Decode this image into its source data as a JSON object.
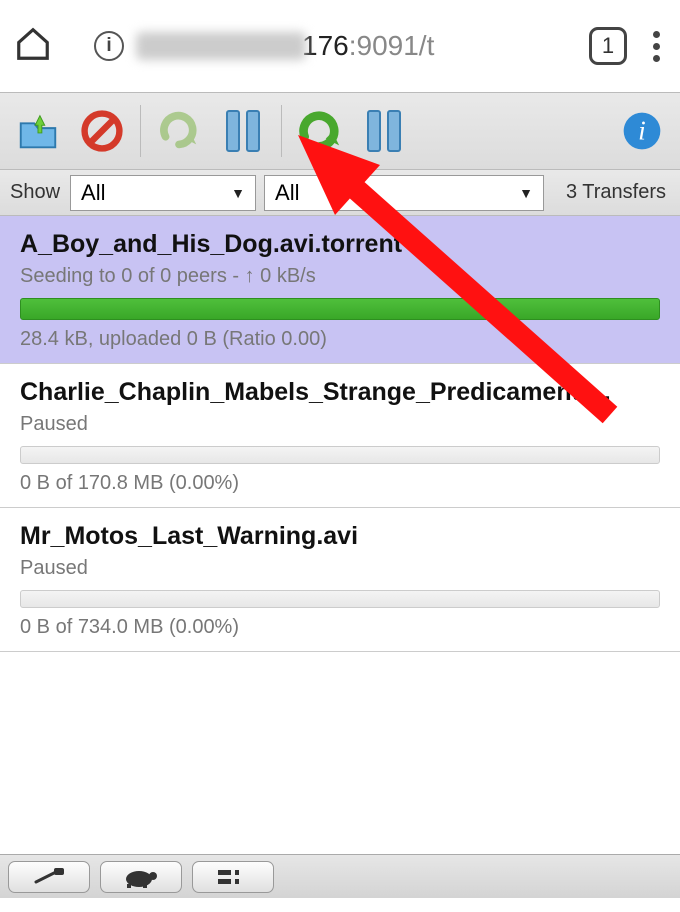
{
  "browser": {
    "url_visible": "176",
    "url_port": ":9091",
    "url_path": "/t",
    "tab_count": "1"
  },
  "filters": {
    "show_label": "Show",
    "state": "All",
    "tracker": "All",
    "count_text": "3 Transfers"
  },
  "torrents": [
    {
      "title": "A_Boy_and_His_Dog.avi.torrent",
      "status": "Seeding to 0 of 0 peers - ↑ 0 kB/s",
      "footer": "28.4 kB, uploaded 0 B (Ratio 0.00)",
      "selected": true,
      "bar": "green"
    },
    {
      "title": "Charlie_Chaplin_Mabels_Strange_Predicament.…",
      "status": "Paused",
      "footer": "0 B of 170.8 MB (0.00%)",
      "selected": false,
      "bar": "grey"
    },
    {
      "title": "Mr_Motos_Last_Warning.avi",
      "status": "Paused",
      "footer": "0 B of 734.0 MB (0.00%)",
      "selected": false,
      "bar": "grey"
    }
  ]
}
